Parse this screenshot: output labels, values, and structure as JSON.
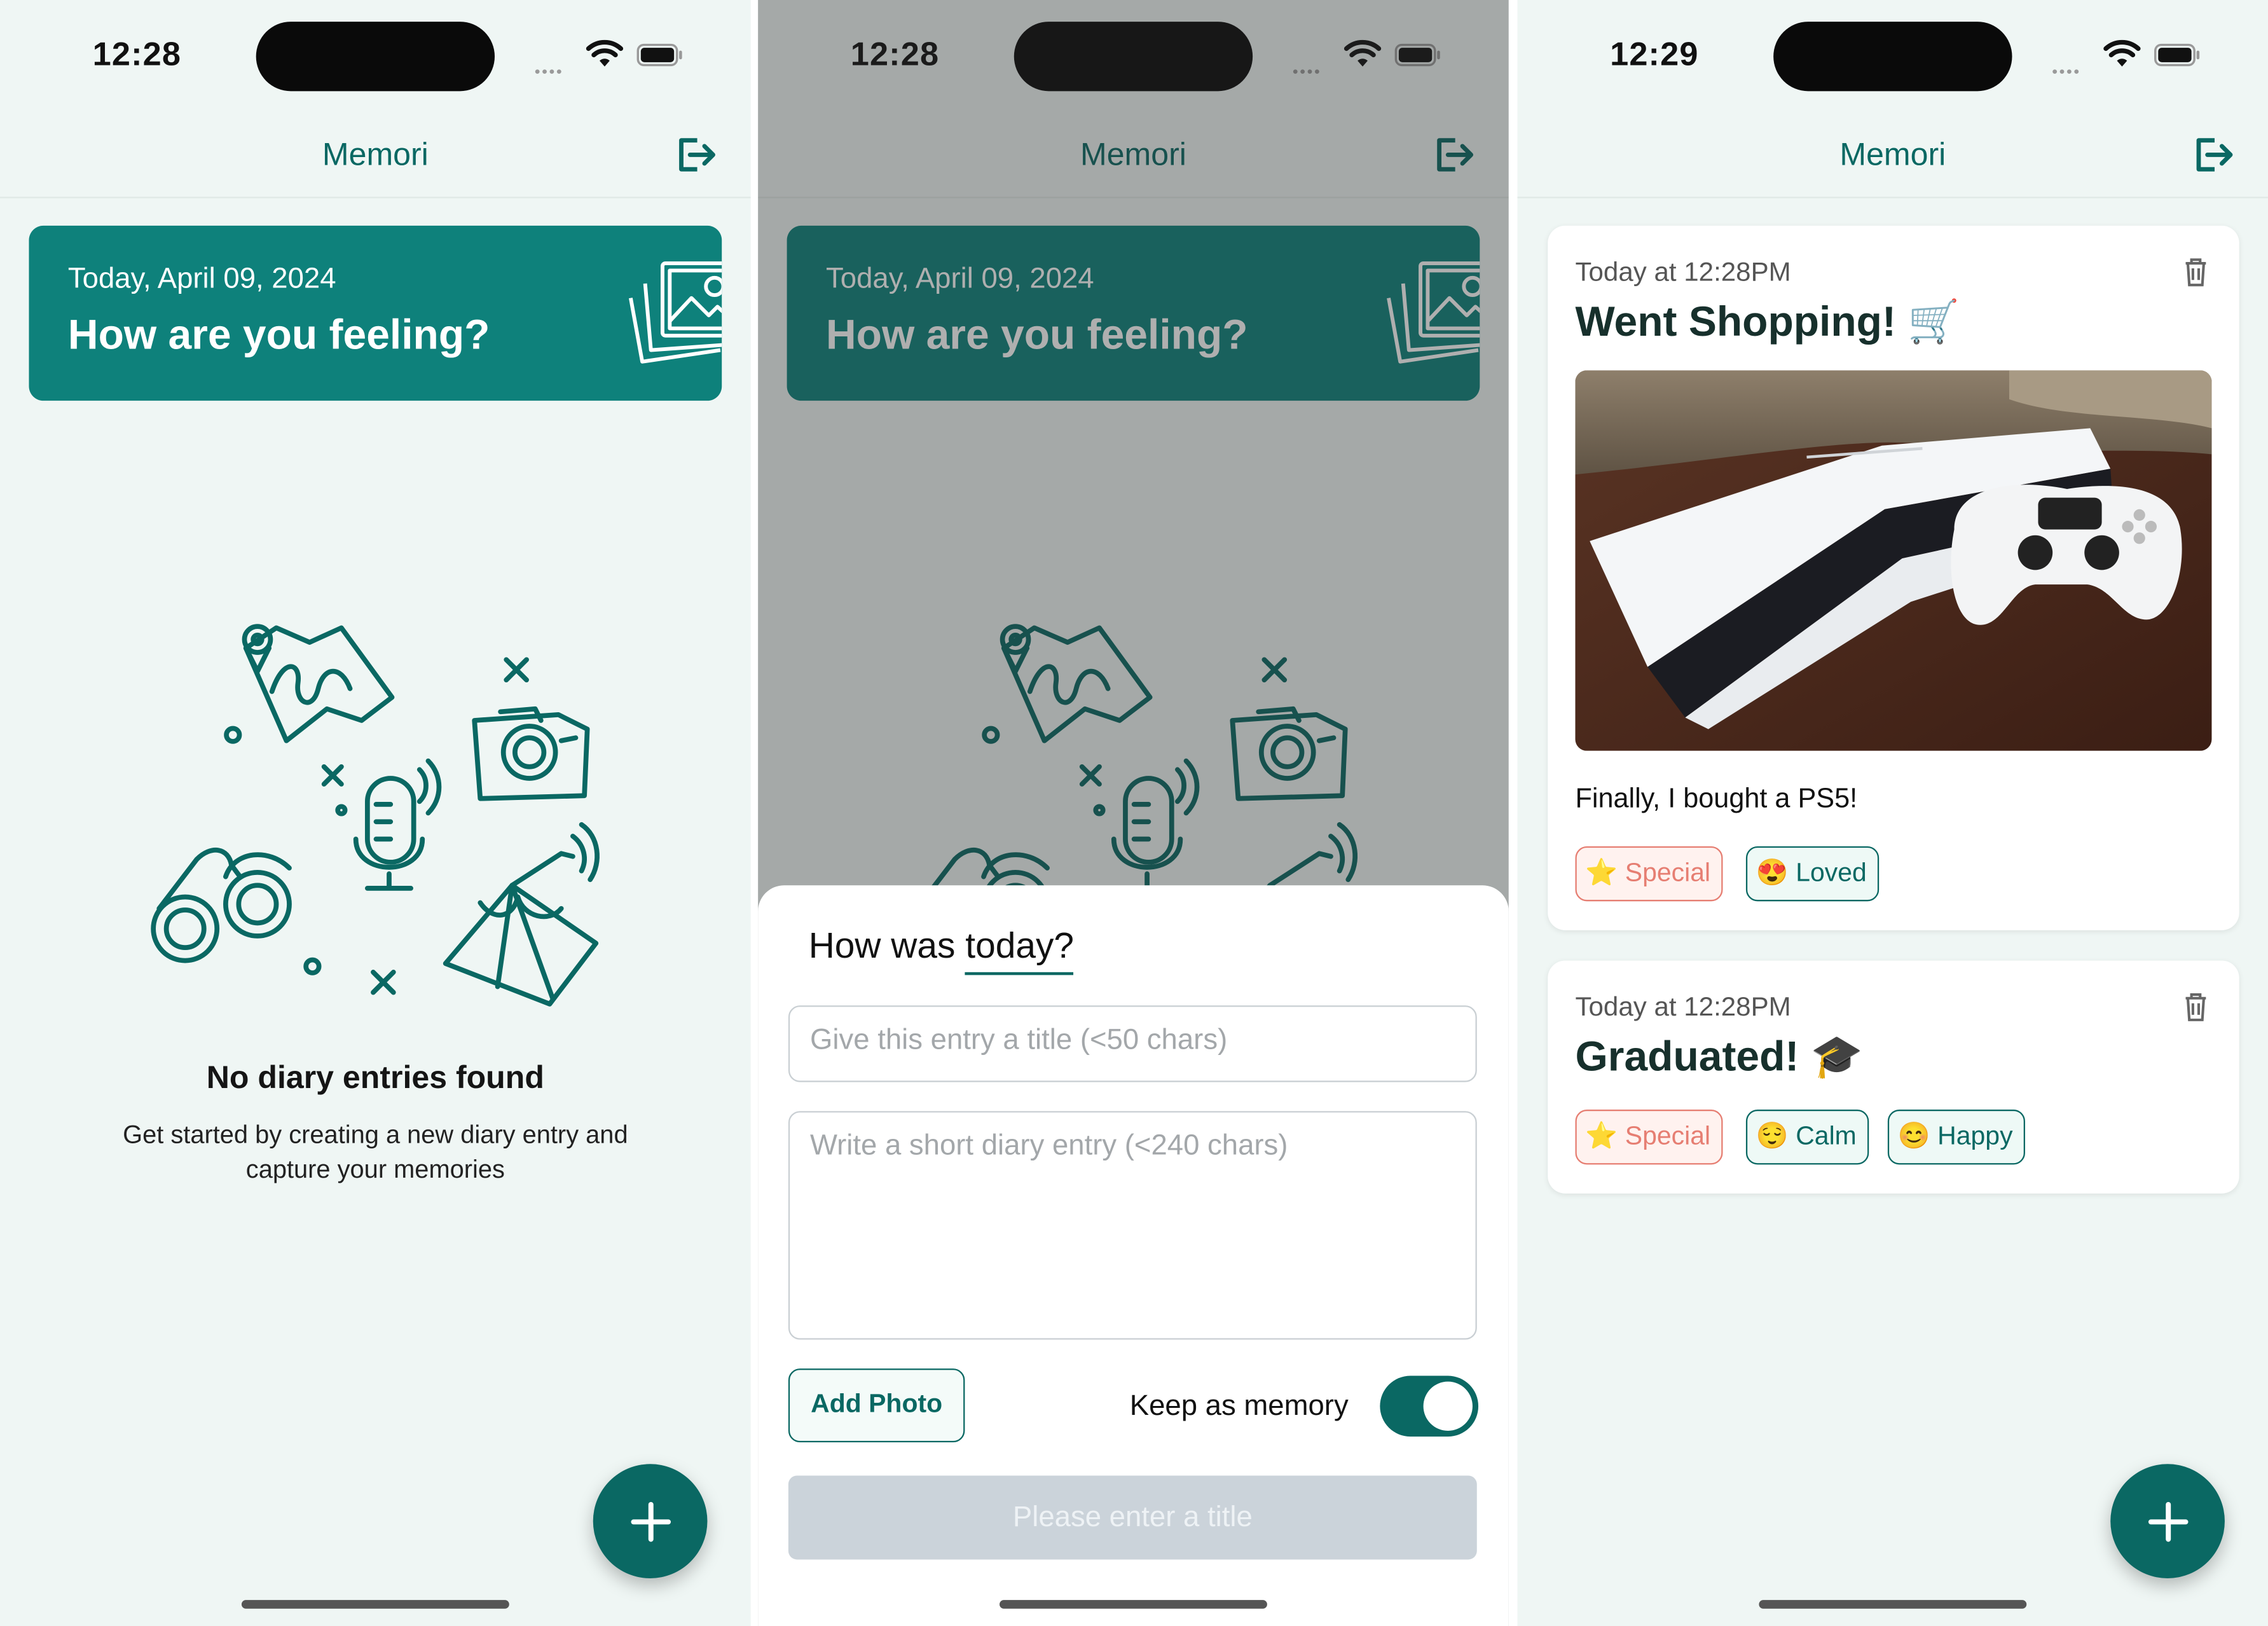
{
  "app": {
    "title": "Memori"
  },
  "screens": [
    {
      "time": "12:28"
    },
    {
      "time": "12:28"
    },
    {
      "time": "12:29"
    }
  ],
  "hero": {
    "date": "Today, April 09, 2024",
    "question": "How are you feeling?"
  },
  "empty_state": {
    "title": "No diary entries found",
    "subtitle": "Get started by creating a new diary entry and capture your memories"
  },
  "sheet": {
    "heading_prefix": "How was",
    "heading_word": "today?",
    "title_placeholder": "Give this entry a title (<50 chars)",
    "body_placeholder": "Write a short diary entry (<240 chars)",
    "add_photo_label": "Add Photo",
    "keep_memory_label": "Keep as memory",
    "keep_memory_on": true,
    "submit_label": "Please enter a title"
  },
  "entries": [
    {
      "time": "Today at 12:28PM",
      "title": "Went Shopping! 🛒",
      "body": "Finally, I bought a PS5!",
      "tags": [
        {
          "emoji": "⭐",
          "label": "Special"
        },
        {
          "emoji": "😍",
          "label": "Loved"
        }
      ]
    },
    {
      "time": "Today at 12:28PM",
      "title": "Graduated! 🎓",
      "tags": [
        {
          "emoji": "⭐",
          "label": "Special"
        },
        {
          "emoji": "😌",
          "label": "Calm"
        },
        {
          "emoji": "😊",
          "label": "Happy"
        }
      ]
    }
  ],
  "colors": {
    "primary": "#0a6863",
    "hero": "#0e817b",
    "background": "#eff6f4",
    "special": "#e67e72",
    "disabled": "#cbd3da"
  },
  "icons": [
    "wifi-icon",
    "battery-icon",
    "logout-icon",
    "photos-icon",
    "trash-icon",
    "plus-icon"
  ]
}
